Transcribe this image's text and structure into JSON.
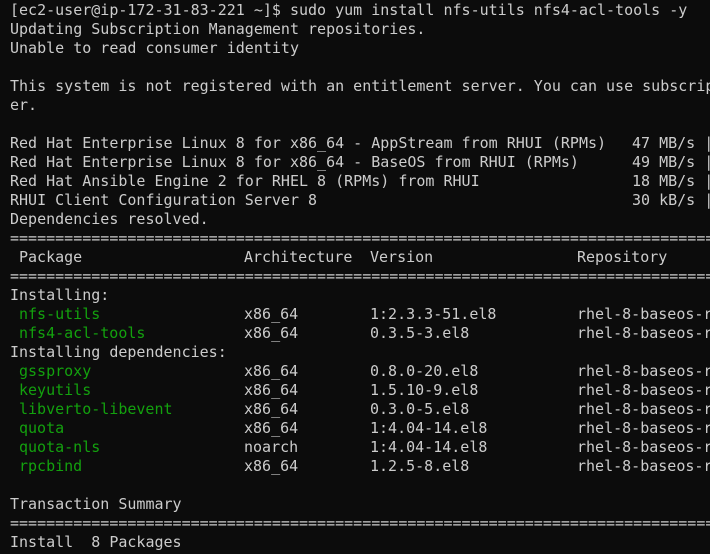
{
  "colors": {
    "background": "#0c0c0c",
    "text": "#cccccc",
    "package_name": "#13a10e"
  },
  "command_line": "[ec2-user@ip-172-31-83-221 ~]$ sudo yum install nfs-utils nfs4-acl-tools -y",
  "messages": [
    "Updating Subscription Management repositories.",
    "Unable to read consumer identity",
    "",
    "This system is not registered with an entitlement server. You can use subscrip",
    "er.",
    ""
  ],
  "repos": [
    {
      "name": "Red Hat Enterprise Linux 8 for x86_64 - AppStream from RHUI (RPMs)",
      "speed": "47 MB/s |"
    },
    {
      "name": "Red Hat Enterprise Linux 8 for x86_64 - BaseOS from RHUI (RPMs)",
      "speed": "49 MB/s |"
    },
    {
      "name": "Red Hat Ansible Engine 2 for RHEL 8 (RPMs) from RHUI",
      "speed": "18 MB/s |"
    },
    {
      "name": "RHUI Client Configuration Server 8",
      "speed": "30 kB/s |"
    }
  ],
  "dependencies_resolved": "Dependencies resolved.",
  "separator": "==========================================================================================",
  "table": {
    "headers": [
      "Package",
      "Architecture",
      "Version",
      "Repository"
    ],
    "sections": [
      {
        "title": "Installing:",
        "rows": [
          {
            "package": "nfs-utils",
            "arch": "x86_64",
            "version": "1:2.3.3-51.el8",
            "repo": "rhel-8-baseos-r"
          },
          {
            "package": "nfs4-acl-tools",
            "arch": "x86_64",
            "version": "0.3.5-3.el8",
            "repo": "rhel-8-baseos-r"
          }
        ]
      },
      {
        "title": "Installing dependencies:",
        "rows": [
          {
            "package": "gssproxy",
            "arch": "x86_64",
            "version": "0.8.0-20.el8",
            "repo": "rhel-8-baseos-r"
          },
          {
            "package": "keyutils",
            "arch": "x86_64",
            "version": "1.5.10-9.el8",
            "repo": "rhel-8-baseos-r"
          },
          {
            "package": "libverto-libevent",
            "arch": "x86_64",
            "version": "0.3.0-5.el8",
            "repo": "rhel-8-baseos-r"
          },
          {
            "package": "quota",
            "arch": "x86_64",
            "version": "1:4.04-14.el8",
            "repo": "rhel-8-baseos-r"
          },
          {
            "package": "quota-nls",
            "arch": "noarch",
            "version": "1:4.04-14.el8",
            "repo": "rhel-8-baseos-r"
          },
          {
            "package": "rpcbind",
            "arch": "x86_64",
            "version": "1.2.5-8.el8",
            "repo": "rhel-8-baseos-r"
          }
        ]
      }
    ]
  },
  "transaction_summary": "Transaction Summary",
  "install_summary": "Install  8 Packages"
}
